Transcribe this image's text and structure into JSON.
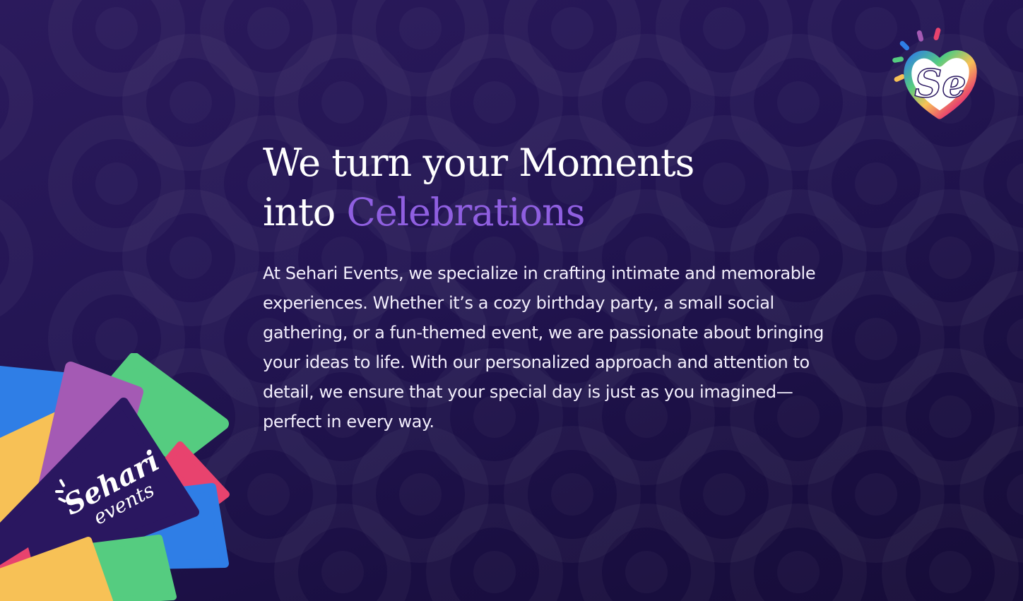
{
  "brand": {
    "name_line1": "Sehari",
    "name_line2": "events",
    "monogram": "Se"
  },
  "hero": {
    "headline_line1": "We turn your Moments",
    "headline_line2_prefix": "into ",
    "headline_accent": "Celebrations",
    "paragraph": "At Sehari Events, we specialize in crafting intimate and memorable experiences. Whether it’s a cozy birthday party, a small social gathering, or a fun-themed event, we are passionate about bringing your ideas to life. With our personalized approach and attention to detail, we ensure that your special day is just as you imagined—perfect in every way."
  },
  "colors": {
    "background": "#231553",
    "accent": "#8f5fe0",
    "text": "#ffffff",
    "card_blue": "#2f7ee6",
    "card_purple": "#a45ab4",
    "card_green": "#55cc80",
    "card_pink": "#e8436e",
    "card_yellow": "#f7c156",
    "card_dark": "#2a1760"
  },
  "icons": [
    "swirl-pattern-icon",
    "heart-logo-icon",
    "sparkle-icon"
  ]
}
